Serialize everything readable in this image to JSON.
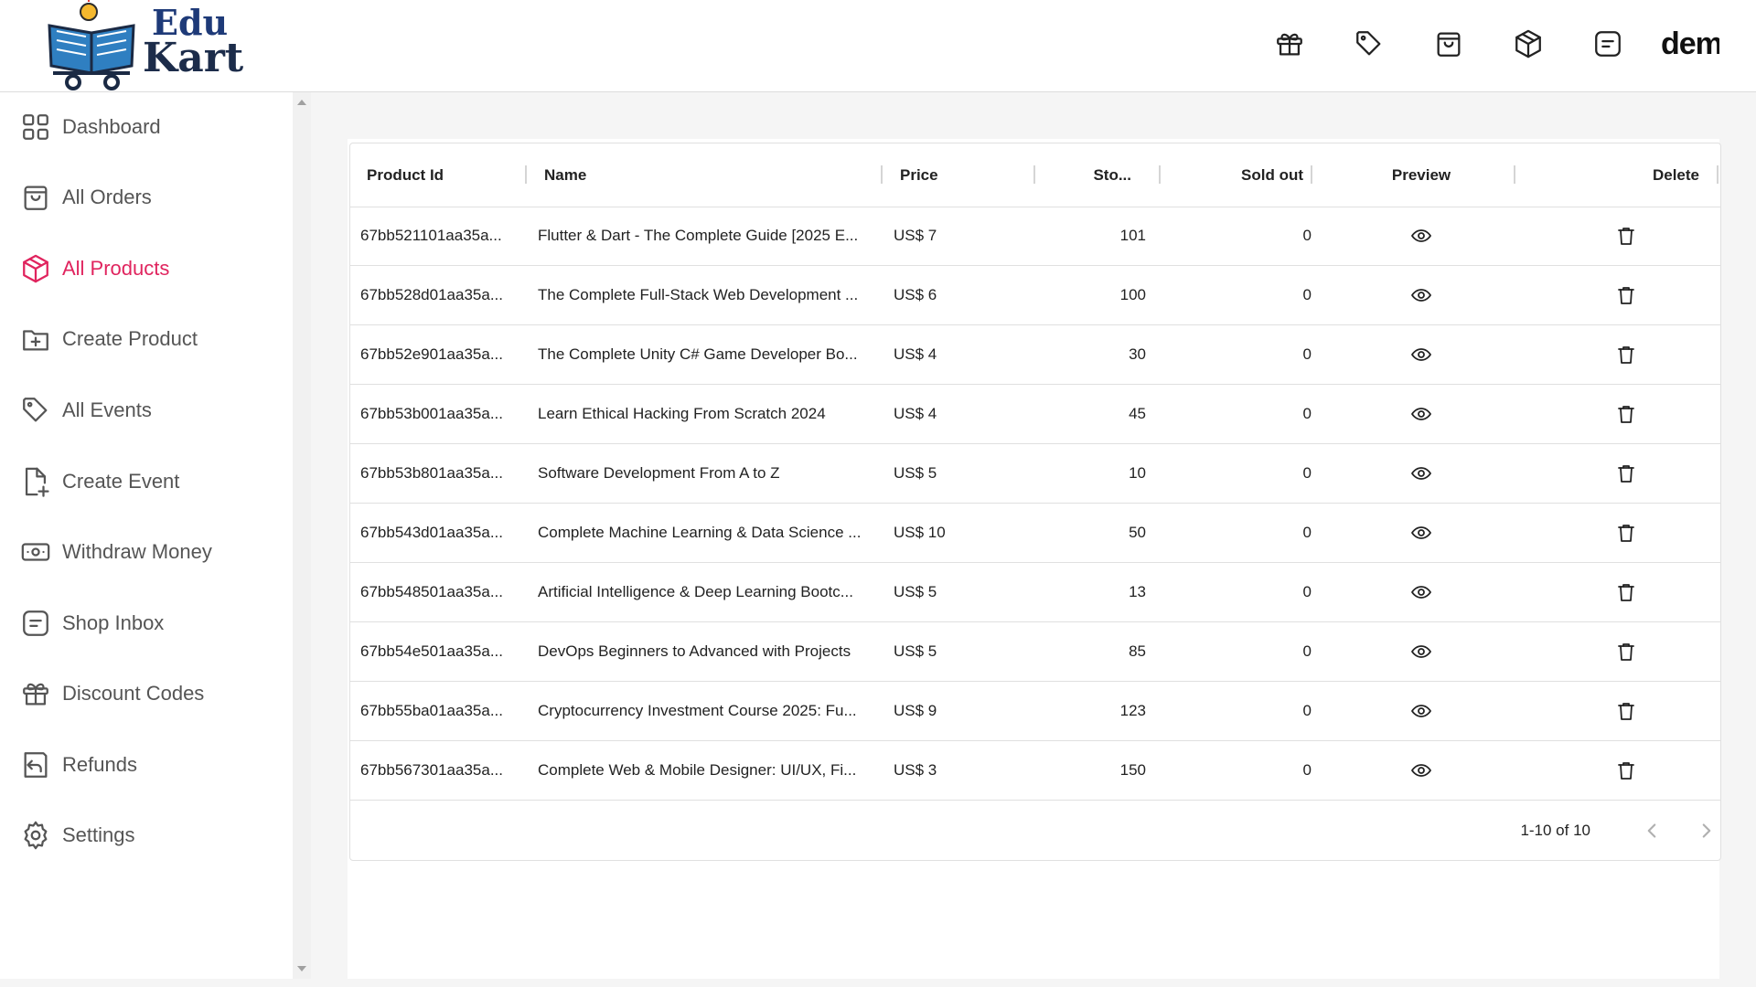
{
  "brand": {
    "line1": "Edu",
    "line2": "Kart"
  },
  "header": {
    "icons": [
      "gift-icon",
      "tag-icon",
      "shopping-bag-icon",
      "package-icon",
      "message-icon"
    ],
    "user_text": "dem"
  },
  "sidebar": {
    "items": [
      {
        "label": "Dashboard",
        "icon": "dashboard-icon"
      },
      {
        "label": "All Orders",
        "icon": "shopping-bag-icon"
      },
      {
        "label": "All Products",
        "icon": "package-icon",
        "active": true
      },
      {
        "label": "Create Product",
        "icon": "folder-plus-icon"
      },
      {
        "label": "All Events",
        "icon": "tag-icon"
      },
      {
        "label": "Create Event",
        "icon": "file-plus-icon"
      },
      {
        "label": "Withdraw Money",
        "icon": "money-icon"
      },
      {
        "label": "Shop Inbox",
        "icon": "message-icon"
      },
      {
        "label": "Discount Codes",
        "icon": "gift-icon"
      },
      {
        "label": "Refunds",
        "icon": "refund-icon"
      },
      {
        "label": "Settings",
        "icon": "gear-icon"
      }
    ]
  },
  "table": {
    "columns": [
      "Product Id",
      "Name",
      "Price",
      "Sto...",
      "Sold out",
      "Preview",
      "Delete"
    ],
    "rows": [
      {
        "id": "67bb521101aa35a...",
        "name": "Flutter & Dart - The Complete Guide [2025 E...",
        "price": "US$ 7",
        "stock": "101",
        "sold": "0"
      },
      {
        "id": "67bb528d01aa35a...",
        "name": "The Complete Full-Stack Web Development ...",
        "price": "US$ 6",
        "stock": "100",
        "sold": "0"
      },
      {
        "id": "67bb52e901aa35a...",
        "name": "The Complete Unity C# Game Developer Bo...",
        "price": "US$ 4",
        "stock": "30",
        "sold": "0"
      },
      {
        "id": "67bb53b001aa35a...",
        "name": "Learn Ethical Hacking From Scratch 2024",
        "price": "US$ 4",
        "stock": "45",
        "sold": "0"
      },
      {
        "id": "67bb53b801aa35a...",
        "name": "Software Development From A to Z",
        "price": "US$ 5",
        "stock": "10",
        "sold": "0"
      },
      {
        "id": "67bb543d01aa35a...",
        "name": "Complete Machine Learning & Data Science ...",
        "price": "US$ 10",
        "stock": "50",
        "sold": "0"
      },
      {
        "id": "67bb548501aa35a...",
        "name": "Artificial Intelligence & Deep Learning Bootc...",
        "price": "US$ 5",
        "stock": "13",
        "sold": "0"
      },
      {
        "id": "67bb54e501aa35a...",
        "name": "DevOps Beginners to Advanced with Projects",
        "price": "US$ 5",
        "stock": "85",
        "sold": "0"
      },
      {
        "id": "67bb55ba01aa35a...",
        "name": "Cryptocurrency Investment Course 2025: Fu...",
        "price": "US$ 9",
        "stock": "123",
        "sold": "0"
      },
      {
        "id": "67bb567301aa35a...",
        "name": "Complete Web & Mobile Designer: UI/UX, Fi...",
        "price": "US$ 3",
        "stock": "150",
        "sold": "0"
      }
    ],
    "pagination": "1-10 of 10"
  },
  "colors": {
    "accent": "#e0245e",
    "sidebar_text": "#555555"
  }
}
